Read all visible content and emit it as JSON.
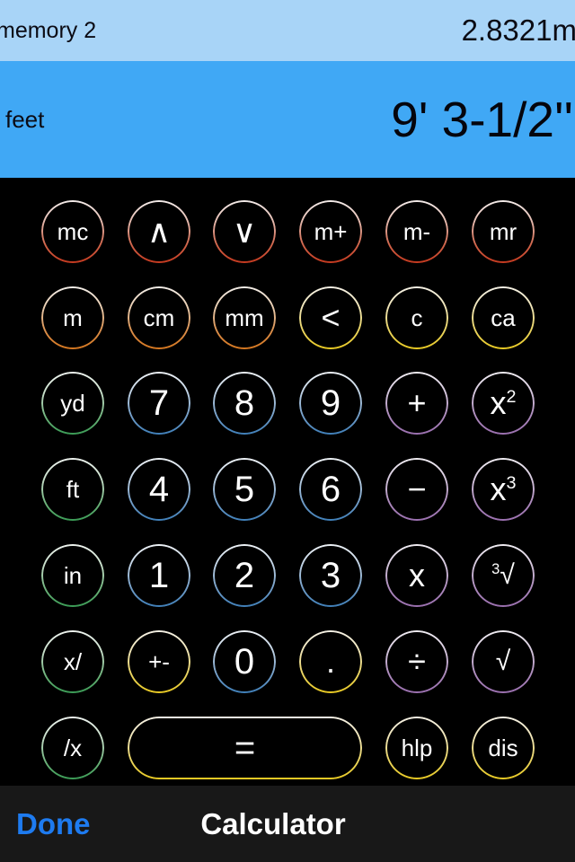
{
  "memory": {
    "label": "memory 2",
    "value": "2.8321m"
  },
  "display": {
    "unit": "feet",
    "value": "9' 3-1/2''"
  },
  "footer": {
    "done_label": "Done",
    "title": "Calculator"
  },
  "colors": {
    "memory_bar": "#a8d4f7",
    "display_bar": "#40a8f5",
    "keypad_background": "#000000",
    "footer_background": "#181818",
    "done_accent": "#1e7bf0",
    "ring_red": "#c4391f",
    "ring_orange": "#d4761f",
    "ring_yellow": "#e7c821",
    "ring_green": "#3a9b55",
    "ring_blue": "#3f7fb8",
    "ring_purple": "#9a6fae"
  },
  "keys": [
    {
      "id": "mc",
      "label": "mc",
      "color": "red",
      "row": 0,
      "col": 0,
      "size": "small"
    },
    {
      "id": "up",
      "label": "∧",
      "color": "red",
      "row": 0,
      "col": 1,
      "size": "op"
    },
    {
      "id": "down",
      "label": "∨",
      "color": "red",
      "row": 0,
      "col": 2,
      "size": "op"
    },
    {
      "id": "m-plus",
      "label": "m+",
      "color": "red",
      "row": 0,
      "col": 3,
      "size": "small"
    },
    {
      "id": "m-minus",
      "label": "m-",
      "color": "red",
      "row": 0,
      "col": 4,
      "size": "small"
    },
    {
      "id": "mr",
      "label": "mr",
      "color": "red",
      "row": 0,
      "col": 5,
      "size": "small"
    },
    {
      "id": "m",
      "label": "m",
      "color": "orange",
      "row": 1,
      "col": 0,
      "size": "small"
    },
    {
      "id": "cm",
      "label": "cm",
      "color": "orange",
      "row": 1,
      "col": 1,
      "size": "small"
    },
    {
      "id": "mm",
      "label": "mm",
      "color": "orange",
      "row": 1,
      "col": 2,
      "size": "small"
    },
    {
      "id": "backspace",
      "label": "<",
      "color": "yellow",
      "row": 1,
      "col": 3,
      "size": "op"
    },
    {
      "id": "c",
      "label": "c",
      "color": "yellow",
      "row": 1,
      "col": 4,
      "size": "small"
    },
    {
      "id": "ca",
      "label": "ca",
      "color": "yellow",
      "row": 1,
      "col": 5,
      "size": "small"
    },
    {
      "id": "yd",
      "label": "yd",
      "color": "green",
      "row": 2,
      "col": 0,
      "size": "small"
    },
    {
      "id": "7",
      "label": "7",
      "color": "blue",
      "row": 2,
      "col": 1,
      "size": "digit"
    },
    {
      "id": "8",
      "label": "8",
      "color": "blue",
      "row": 2,
      "col": 2,
      "size": "digit"
    },
    {
      "id": "9",
      "label": "9",
      "color": "blue",
      "row": 2,
      "col": 3,
      "size": "digit"
    },
    {
      "id": "plus",
      "label": "+",
      "color": "purple",
      "row": 2,
      "col": 4,
      "size": "op"
    },
    {
      "id": "x-squared",
      "label": "x²",
      "color": "purple",
      "row": 2,
      "col": 5,
      "size": "op",
      "sup": "2",
      "base": "x"
    },
    {
      "id": "ft",
      "label": "ft",
      "color": "green",
      "row": 3,
      "col": 0,
      "size": "small"
    },
    {
      "id": "4",
      "label": "4",
      "color": "blue",
      "row": 3,
      "col": 1,
      "size": "digit"
    },
    {
      "id": "5",
      "label": "5",
      "color": "blue",
      "row": 3,
      "col": 2,
      "size": "digit"
    },
    {
      "id": "6",
      "label": "6",
      "color": "blue",
      "row": 3,
      "col": 3,
      "size": "digit"
    },
    {
      "id": "minus",
      "label": "−",
      "color": "purple",
      "row": 3,
      "col": 4,
      "size": "op"
    },
    {
      "id": "x-cubed",
      "label": "x³",
      "color": "purple",
      "row": 3,
      "col": 5,
      "size": "op",
      "sup": "3",
      "base": "x"
    },
    {
      "id": "in",
      "label": "in",
      "color": "green",
      "row": 4,
      "col": 0,
      "size": "small"
    },
    {
      "id": "1",
      "label": "1",
      "color": "blue",
      "row": 4,
      "col": 1,
      "size": "digit"
    },
    {
      "id": "2",
      "label": "2",
      "color": "blue",
      "row": 4,
      "col": 2,
      "size": "digit"
    },
    {
      "id": "3",
      "label": "3",
      "color": "blue",
      "row": 4,
      "col": 3,
      "size": "digit"
    },
    {
      "id": "multiply",
      "label": "x",
      "color": "purple",
      "row": 4,
      "col": 4,
      "size": "op"
    },
    {
      "id": "cube-root",
      "label": "³√",
      "color": "purple",
      "row": 4,
      "col": 5,
      "size": "root"
    },
    {
      "id": "x-over",
      "label": "x/",
      "color": "green",
      "row": 5,
      "col": 0,
      "size": "small"
    },
    {
      "id": "plus-minus",
      "label": "+-",
      "color": "yellow",
      "row": 5,
      "col": 1,
      "size": "small"
    },
    {
      "id": "0",
      "label": "0",
      "color": "blue",
      "row": 5,
      "col": 2,
      "size": "digit"
    },
    {
      "id": "decimal",
      "label": ".",
      "color": "yellow",
      "row": 5,
      "col": 3,
      "size": "op"
    },
    {
      "id": "divide",
      "label": "÷",
      "color": "purple",
      "row": 5,
      "col": 4,
      "size": "op"
    },
    {
      "id": "sqrt",
      "label": "√",
      "color": "purple",
      "row": 5,
      "col": 5,
      "size": "root"
    },
    {
      "id": "over-x",
      "label": "/x",
      "color": "green",
      "row": 6,
      "col": 0,
      "size": "small"
    },
    {
      "id": "equals",
      "label": "=",
      "color": "yellow",
      "row": 6,
      "col": 1,
      "size": "eq",
      "wide": true
    },
    {
      "id": "hlp",
      "label": "hlp",
      "color": "yellow",
      "row": 6,
      "col": 4,
      "size": "small"
    },
    {
      "id": "dis",
      "label": "dis",
      "color": "yellow",
      "row": 6,
      "col": 5,
      "size": "small"
    }
  ]
}
